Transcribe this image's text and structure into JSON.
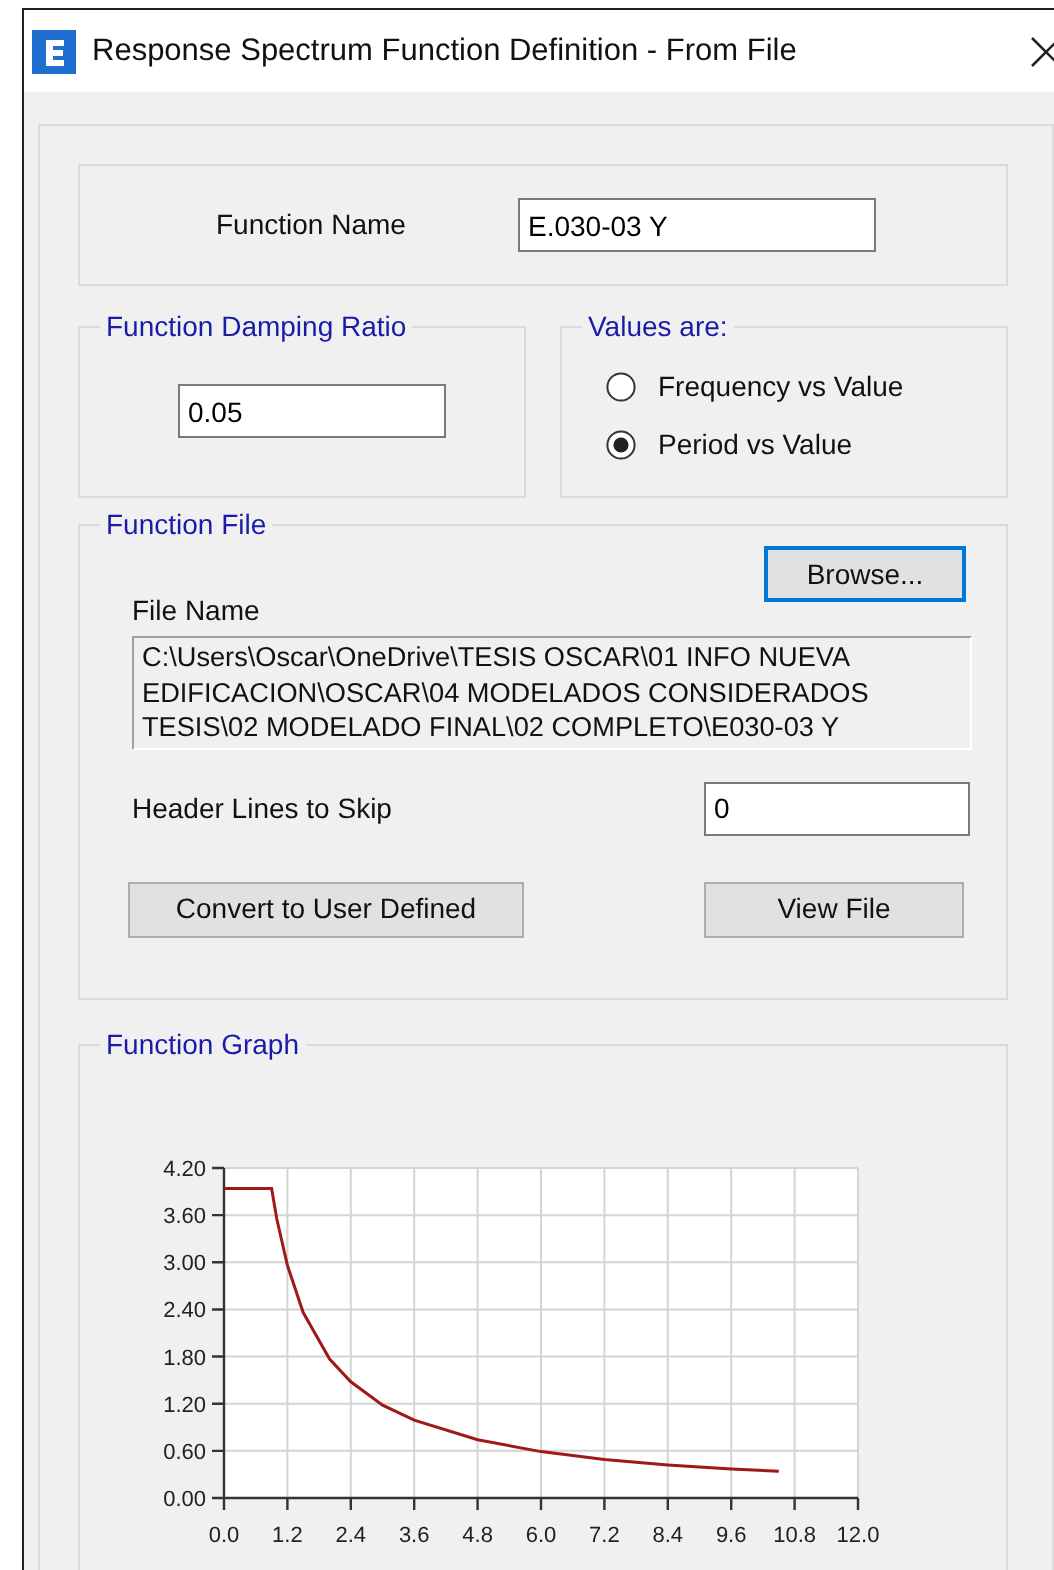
{
  "window": {
    "title": "Response Spectrum Function Definition - From File"
  },
  "function_name": {
    "label": "Function Name",
    "value": "E.030-03 Y"
  },
  "damping": {
    "legend": "Function Damping Ratio",
    "value": "0.05"
  },
  "values_are": {
    "legend": "Values are:",
    "options": [
      {
        "label": "Frequency vs Value",
        "selected": false
      },
      {
        "label": "Period vs Value",
        "selected": true
      }
    ]
  },
  "function_file": {
    "legend": "Function File",
    "browse_button": "Browse...",
    "file_name_label": "File Name",
    "file_path": "C:\\Users\\Oscar\\OneDrive\\TESIS OSCAR\\01 INFO NUEVA EDIFICACION\\OSCAR\\04 MODELADOS CONSIDERADOS TESIS\\02 MODELADO FINAL\\02 COMPLETO\\E030-03 Y",
    "header_lines_label": "Header Lines to Skip",
    "header_lines_value": "0",
    "convert_button": "Convert to User Defined",
    "view_button": "View File"
  },
  "function_graph": {
    "legend": "Function Graph",
    "chart_data": {
      "type": "line",
      "x": [
        0,
        0.9,
        1.0,
        1.2,
        1.5,
        2.0,
        2.4,
        3.0,
        3.6,
        4.8,
        6.0,
        7.2,
        8.4,
        9.6,
        10.5
      ],
      "grid": true,
      "series": [
        {
          "color": "#a01818",
          "values": [
            3.94,
            3.94,
            3.55,
            2.96,
            2.36,
            1.77,
            1.48,
            1.18,
            0.99,
            0.74,
            0.59,
            0.49,
            0.42,
            0.37,
            0.34
          ]
        }
      ],
      "xlim": [
        0,
        12
      ],
      "ylim": [
        0,
        4.2
      ],
      "xticks": [
        {
          "value": 0,
          "label": "0.0"
        },
        {
          "value": 1.2,
          "label": "1.2"
        },
        {
          "value": 2.4,
          "label": "2.4"
        },
        {
          "value": 3.6,
          "label": "3.6"
        },
        {
          "value": 4.8,
          "label": "4.8"
        },
        {
          "value": 6,
          "label": "6.0"
        },
        {
          "value": 7.2,
          "label": "7.2"
        },
        {
          "value": 8.4,
          "label": "8.4"
        },
        {
          "value": 9.6,
          "label": "9.6"
        },
        {
          "value": 10.8,
          "label": "10.8"
        },
        {
          "value": 12,
          "label": "12.0"
        }
      ],
      "yticks": [
        {
          "value": 0,
          "label": "0.00"
        },
        {
          "value": 0.6,
          "label": "0.60"
        },
        {
          "value": 1.2,
          "label": "1.20"
        },
        {
          "value": 1.8,
          "label": "1.80"
        },
        {
          "value": 2.4,
          "label": "2.40"
        },
        {
          "value": 3.0,
          "label": "3.00"
        },
        {
          "value": 3.6,
          "label": "3.60"
        },
        {
          "value": 4.2,
          "label": "4.20"
        }
      ]
    }
  }
}
